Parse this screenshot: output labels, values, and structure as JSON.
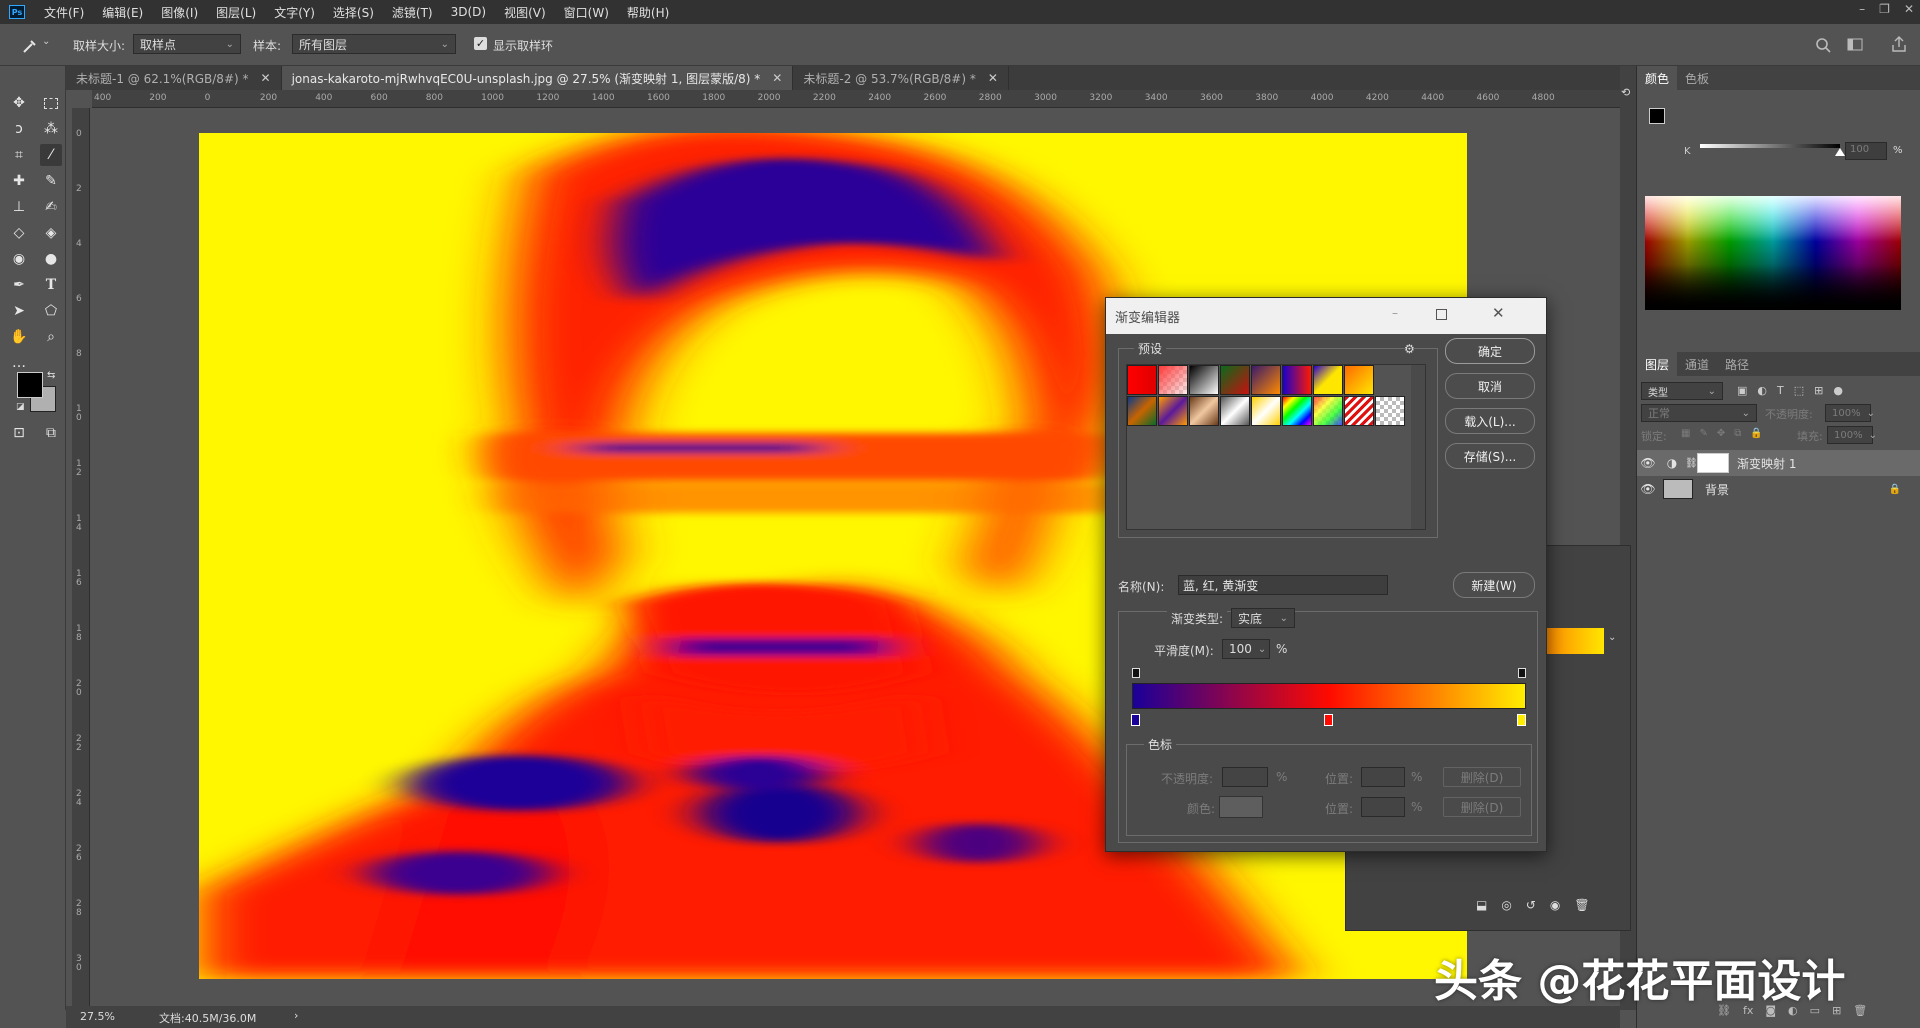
{
  "menubar": {
    "logo": "Ps",
    "items": [
      "文件(F)",
      "编辑(E)",
      "图像(I)",
      "图层(L)",
      "文字(Y)",
      "选择(S)",
      "滤镜(T)",
      "3D(D)",
      "视图(V)",
      "窗口(W)",
      "帮助(H)"
    ],
    "window_controls": [
      "–",
      "❐",
      "✕"
    ]
  },
  "options": {
    "sample_size_label": "取样大小:",
    "sample_size_value": "取样点",
    "sample_label": "样本:",
    "sample_value": "所有图层",
    "show_ring_label": "显示取样环",
    "show_ring_checked": true
  },
  "tabs": [
    {
      "label": "未标题-1 @ 62.1%(RGB/8#) *",
      "active": false
    },
    {
      "label": "jonas-kakaroto-mjRwhvqEC0U-unsplash.jpg @ 27.5% (渐变映射 1, 图层蒙版/8) *",
      "active": true
    },
    {
      "label": "未标题-2 @ 53.7%(RGB/8#) *",
      "active": false
    }
  ],
  "ruler_h": [
    "400",
    "200",
    "0",
    "200",
    "400",
    "600",
    "800",
    "1000",
    "1200",
    "1400",
    "1600",
    "1800",
    "2000",
    "2200",
    "2400",
    "2600",
    "2800",
    "3000",
    "3200",
    "3400",
    "3600",
    "3800",
    "4000",
    "4200",
    "4400",
    "4600",
    "4800"
  ],
  "ruler_v": [
    "0",
    "2",
    "4",
    "6",
    "8",
    "1 0",
    "1 2",
    "1 4",
    "1 6",
    "1 8",
    "2 0",
    "2 2",
    "2 4",
    "2 6",
    "2 8",
    "3 0",
    "3 2"
  ],
  "status": {
    "zoom": "27.5%",
    "doc": "文档:40.5M/36.0M",
    "arrow": "›"
  },
  "color_panel": {
    "tabs": [
      "颜色",
      "色板"
    ],
    "slider_label": "K",
    "slider_value": "100",
    "percent": "%"
  },
  "layers_panel": {
    "tabs": [
      "图层",
      "通道",
      "路径"
    ],
    "filter_placeholder": "类型",
    "blend_mode": "正常",
    "opacity_label": "不透明度:",
    "opacity_value": "100%",
    "lock_label": "锁定:",
    "fill_label": "填充:",
    "fill_value": "100%",
    "layers": [
      {
        "name": "渐变映射 1",
        "selected": true
      },
      {
        "name": "背景",
        "selected": false
      }
    ]
  },
  "dialog": {
    "title": "渐变编辑器",
    "presets_label": "预设",
    "ok": "确定",
    "cancel": "取消",
    "load": "载入(L)...",
    "save": "存储(S)...",
    "name_label": "名称(N):",
    "name_value": "蓝, 红, 黄渐变",
    "new": "新建(W)",
    "type_label": "渐变类型:",
    "type_value": "实底",
    "smooth_label": "平滑度(M):",
    "smooth_value": "100",
    "percent": "%",
    "stops_group": "色标",
    "opacity_label": "不透明度:",
    "position_label": "位置:",
    "delete_label": "删除(D)",
    "color_label": "颜色:",
    "gradient_colors": [
      "#1a0099",
      "#ff0a00",
      "#ffee00"
    ]
  },
  "watermark": "头条 @花花平面设计"
}
